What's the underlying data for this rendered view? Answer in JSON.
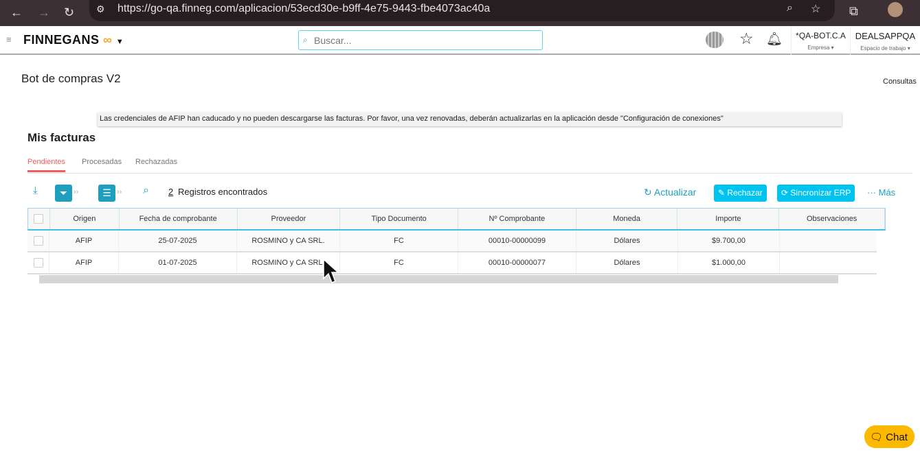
{
  "browser": {
    "url": "https://go-qa.finneg.com/aplicacion/53ecd30e-b9ff-4e75-9443-fbe4073ac40a"
  },
  "appbar": {
    "brand": "FINNEGANS",
    "search_placeholder": "Buscar...",
    "company": "*QA-BOT.C.A",
    "company_label": "Empresa ▾",
    "workspace": "DEALSAPPQA",
    "workspace_label": "Espacio de trabajo ▾"
  },
  "page": {
    "title": "Bot de compras V2",
    "consultas": "Consultas",
    "alert": "Las credenciales de AFIP han caducado y no pueden descargarse las facturas. Por favor, una vez renovadas, deberán actualizarlas en la aplicación desde \"Configuración de conexiones\"",
    "section": "Mis facturas"
  },
  "tabs": [
    "Pendientes",
    "Procesadas",
    "Rechazadas"
  ],
  "toolbar": {
    "count": "2",
    "count_label": "Registros encontrados",
    "refresh": "Actualizar",
    "reject": "Rechazar",
    "sync": "Sincronizar ERP",
    "more": "Más"
  },
  "table": {
    "columns": [
      "Origen",
      "Fecha de comprobante",
      "Proveedor",
      "Tipo Documento",
      "Nº Comprobante",
      "Moneda",
      "Importe",
      "Observaciones"
    ],
    "rows": [
      [
        "AFIP",
        "25-07-2025",
        "ROSMINO y CA SRL.",
        "FC",
        "00010-00000099",
        "Dólares",
        "$9.700,00",
        ""
      ],
      [
        "AFIP",
        "01-07-2025",
        "ROSMINO y CA SRL.",
        "FC",
        "00010-00000077",
        "Dólares",
        "$1.000,00",
        ""
      ]
    ]
  },
  "chat": {
    "label": "Chat"
  },
  "colors": {
    "accent": "#00c3ef",
    "tab_active": "#f25c5c",
    "chat": "#fdb900"
  }
}
